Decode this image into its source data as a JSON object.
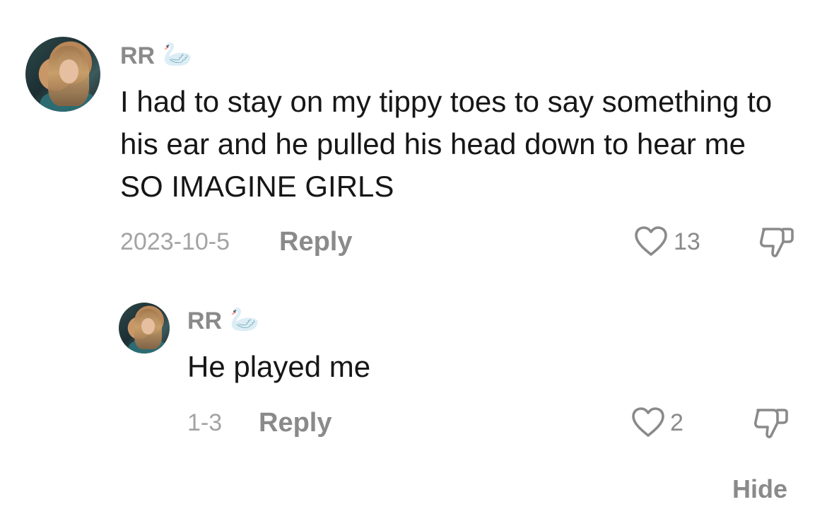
{
  "comment": {
    "username": "RR",
    "badge_emoji": "🦢",
    "text": "I had to stay on my tippy toes to say something to his ear and he pulled his head down to hear me SO IMAGINE GIRLS",
    "date": "2023-10-5",
    "reply_label": "Reply",
    "like_count": "13",
    "icons": {
      "like": "heart-outline-icon",
      "dislike": "thumbs-down-icon"
    }
  },
  "reply": {
    "username": "RR",
    "badge_emoji": "🦢",
    "text": "He played me",
    "date": "1-3",
    "reply_label": "Reply",
    "like_count": "2",
    "icons": {
      "like": "heart-outline-icon",
      "dislike": "thumbs-down-icon"
    }
  },
  "thread": {
    "hide_label": "Hide"
  },
  "colors": {
    "username": "#8a8a8a",
    "body_text": "#161616",
    "meta_text": "#a3a3a3",
    "background": "#ffffff"
  }
}
